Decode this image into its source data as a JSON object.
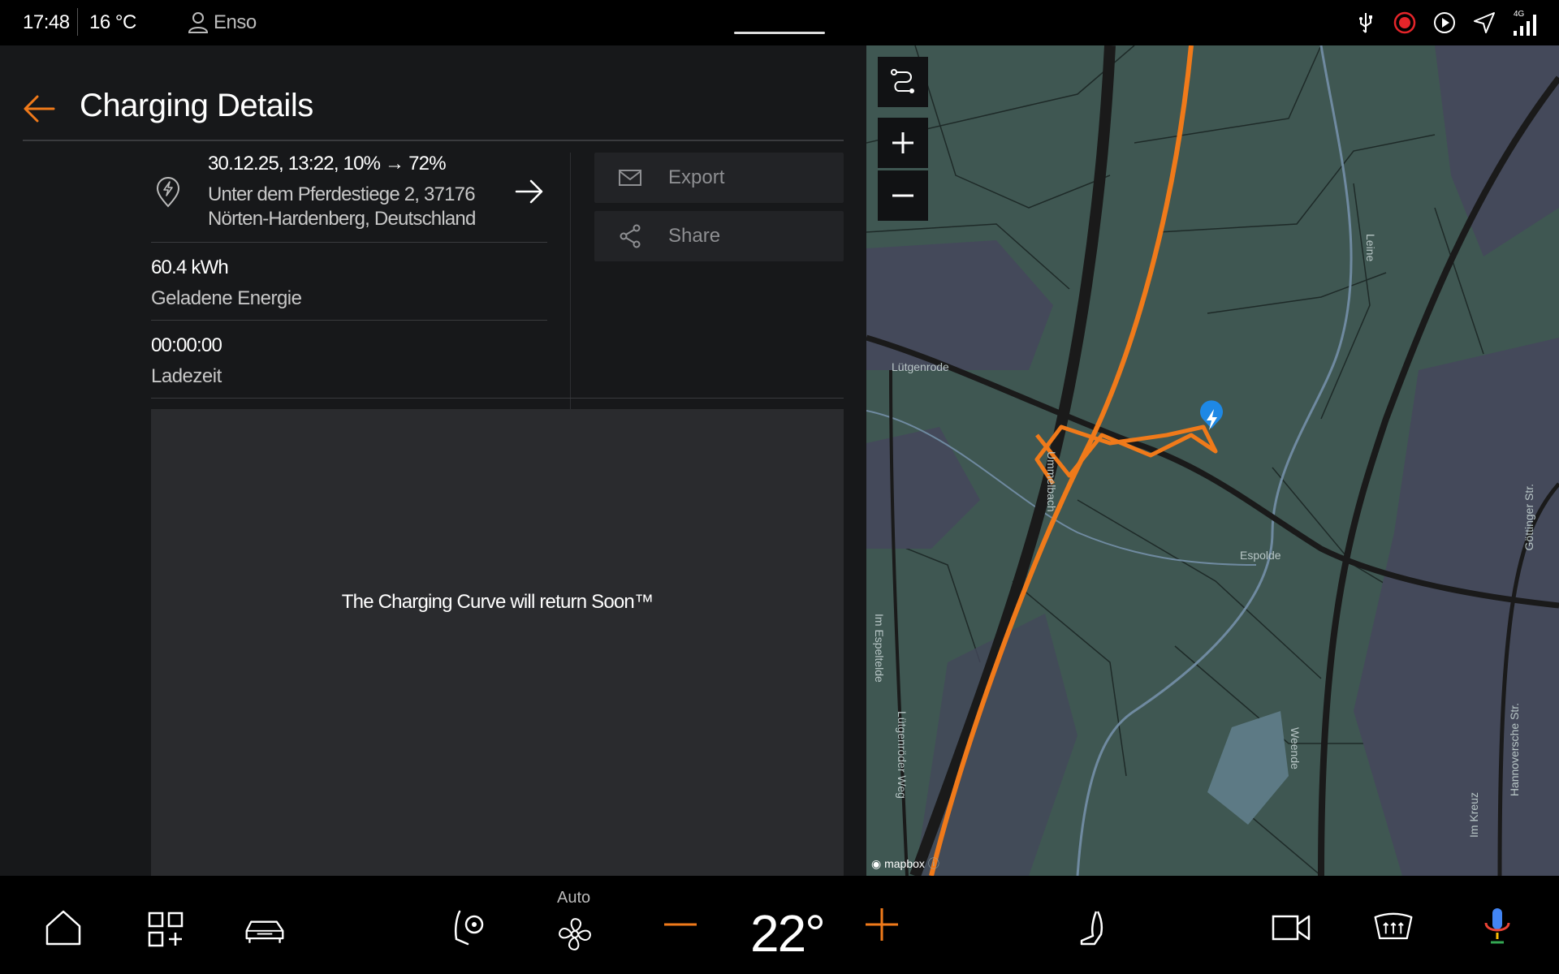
{
  "status": {
    "time": "17:48",
    "temperature": "16 °C",
    "user": "Enso",
    "network": "4G"
  },
  "header": {
    "title": "Charging Details"
  },
  "session": {
    "summary": "30.12.25, 13:22, 10% → 72%",
    "address_line1": "Unter dem Pferdestiege 2, 37176",
    "address_line2": "Nörten-Hardenberg, Deutschland",
    "energy_value": "60.4 kWh",
    "energy_label": "Geladene Energie",
    "duration_value": "00:00:00",
    "duration_label": "Ladezeit"
  },
  "actions": {
    "export_label": "Export",
    "share_label": "Share"
  },
  "chart": {
    "placeholder": "The Charging Curve will return Soon™"
  },
  "map": {
    "attribution": "mapbox",
    "labels": {
      "town": "Lütgenrode",
      "street1": "Im Espeltelde",
      "street2": "Lütgenröder Weg",
      "river1": "Leine",
      "river2": "Espolde",
      "river3": "Weende",
      "stream": "Ummelbach",
      "street3": "Göttinger Str.",
      "street4": "Hannoversche Str.",
      "street5": "Im Kreuz"
    }
  },
  "climate": {
    "mode": "Auto",
    "temperature": "22°"
  },
  "colors": {
    "accent": "#f07a1a",
    "map_bg": "#3f5752",
    "route": "#f07a1a",
    "charger_pin": "#1e88e5"
  }
}
